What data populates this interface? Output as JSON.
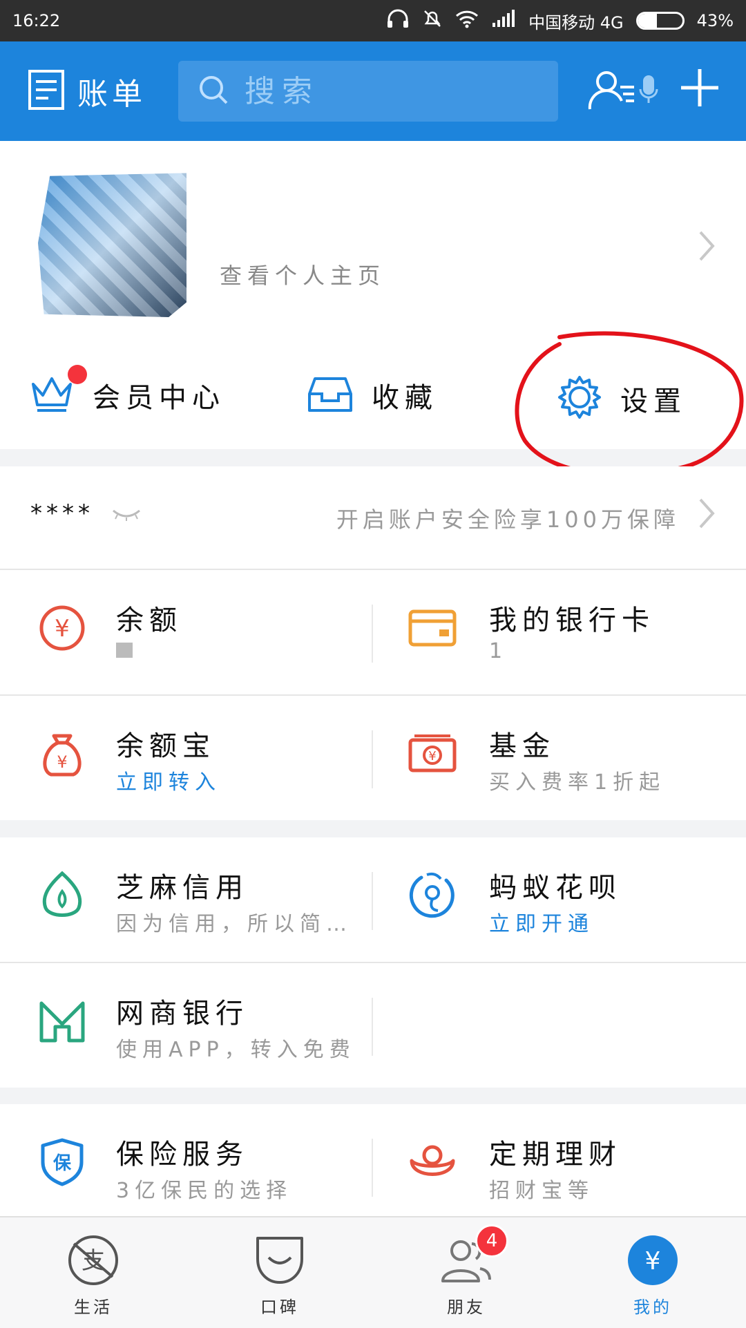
{
  "status_bar": {
    "time": "16:22",
    "carrier": "中国移动 4G",
    "battery": "43%",
    "battery_level": 0.43
  },
  "header": {
    "bill_label": "账单",
    "search_placeholder": "搜索"
  },
  "profile": {
    "subtitle": "查看个人主页"
  },
  "quick_actions": {
    "member": "会员中心",
    "favorites": "收藏",
    "settings": "设置"
  },
  "security": {
    "masked": "****",
    "promo": "开启账户安全险享100万保障"
  },
  "sections": [
    {
      "rows": [
        [
          {
            "title": "余额",
            "sub": "",
            "icon": "yuan-circle-icon"
          },
          {
            "title": "我的银行卡",
            "sub": "1",
            "icon": "bank-card-icon"
          }
        ],
        [
          {
            "title": "余额宝",
            "sub": "立即转入",
            "icon": "money-bag-icon"
          },
          {
            "title": "基金",
            "sub": "买入费率1折起",
            "icon": "fund-icon"
          }
        ]
      ]
    },
    {
      "rows": [
        [
          {
            "title": "芝麻信用",
            "sub": "因为信用，所以简...",
            "icon": "sesame-icon"
          },
          {
            "title": "蚂蚁花呗",
            "sub": "立即开通",
            "icon": "huabei-icon"
          }
        ],
        [
          {
            "title": "网商银行",
            "sub": "使用APP，转入免费",
            "icon": "mybank-icon"
          },
          {
            "title": "",
            "sub": "",
            "icon": ""
          }
        ]
      ]
    },
    {
      "rows": [
        [
          {
            "title": "保险服务",
            "sub": "3亿保民的选择",
            "icon": "insurance-icon"
          },
          {
            "title": "定期理财",
            "sub": "招财宝等",
            "icon": "ingot-icon"
          }
        ]
      ]
    }
  ],
  "tabs": [
    {
      "label": "生活"
    },
    {
      "label": "口碑"
    },
    {
      "label": "朋友",
      "badge": "4"
    },
    {
      "label": "我的"
    }
  ],
  "colors": {
    "brand_blue": "#1d84dc",
    "red": "#e5533f",
    "orange": "#f0a035",
    "green": "#2aa67f"
  }
}
